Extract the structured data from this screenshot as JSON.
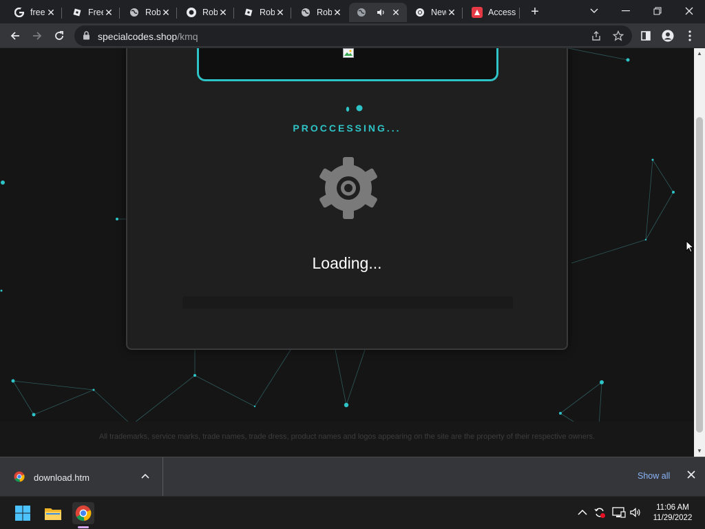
{
  "browser": {
    "tabs": [
      {
        "title": "free",
        "favicon": "google-icon"
      },
      {
        "title": "Free",
        "favicon": "roblox-icon"
      },
      {
        "title": "Robl",
        "favicon": "globe-icon"
      },
      {
        "title": "Robl",
        "favicon": "roblox-logo-icon"
      },
      {
        "title": "Robl",
        "favicon": "roblox-icon"
      },
      {
        "title": "Robl",
        "favicon": "globe-icon"
      },
      {
        "title": "",
        "favicon": "globe-icon",
        "audio": "speaker-icon"
      },
      {
        "title": "New",
        "favicon": "chrome-icon"
      },
      {
        "title": "Access",
        "favicon": "adobe-icon"
      }
    ],
    "url_domain": "specialcodes.shop",
    "url_path": "/kmq"
  },
  "page": {
    "status_text": "PROCCESSING...",
    "loading_text": "Loading...",
    "progress_percent": 0,
    "footer_text": "All trademarks, service marks, trade names, trade dress, product names and logos appearing on the site are the property of their respective owners.",
    "accent_color": "#2ec4c7"
  },
  "downloads": {
    "file_name": "download.htm",
    "show_all_label": "Show all"
  },
  "taskbar": {
    "time": "11:06 AM",
    "date": "11/29/2022"
  }
}
